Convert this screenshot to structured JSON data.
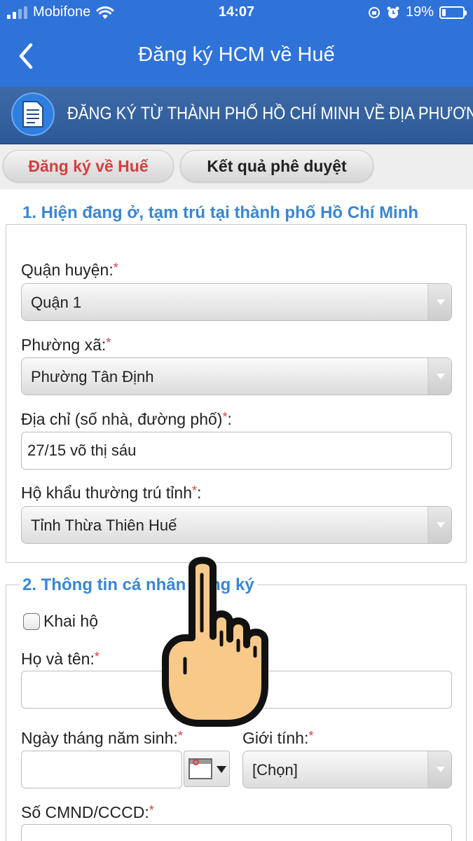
{
  "status_bar": {
    "carrier": "Mobifone",
    "time": "14:07",
    "battery": "19%",
    "battery_level": 0.19
  },
  "nav": {
    "title": "Đăng ký HCM về Huế"
  },
  "banner": {
    "title": "ĐĂNG KÝ TỪ THÀNH PHỐ HỒ CHÍ MINH VỀ ĐỊA PHƯƠNG"
  },
  "tabs": [
    {
      "label": "Đăng ký về Huế",
      "active": true
    },
    {
      "label": "Kết quả phê duyệt",
      "active": false
    }
  ],
  "section1": {
    "legend": "1. Hiện đang ở, tạm trú tại thành phố Hồ Chí Minh",
    "district": {
      "label": "Quận huyện:",
      "value": "Quận 1"
    },
    "ward": {
      "label": "Phường xã:",
      "value": "Phường Tân Định"
    },
    "address": {
      "label": "Địa chỉ (số nhà, đường phố)",
      "suffix": ":",
      "value": "27/15 võ thị sáu"
    },
    "province": {
      "label": "Hộ khẩu thường trú tỉnh",
      "suffix": ":",
      "value": "Tỉnh Thừa Thiên Huế"
    }
  },
  "section2": {
    "legend": "2. Thông tin cá nhân đăng ký",
    "declare_for_other": {
      "label": "Khai hộ",
      "checked": false
    },
    "full_name": {
      "label": "Họ và tên:",
      "value": ""
    },
    "dob": {
      "label": "Ngày tháng năm sinh:",
      "value": ""
    },
    "gender": {
      "label": "Giới tính:",
      "value": "[Chọn]"
    },
    "id_number": {
      "label": "Số CMND/CCCD:",
      "value": ""
    }
  },
  "required_mark": "*",
  "colors": {
    "header_blue": "#2f72d8",
    "banner_blue": "#2c5a98",
    "legend_blue": "#3a86d2",
    "active_tab_red": "#d43f3f"
  }
}
